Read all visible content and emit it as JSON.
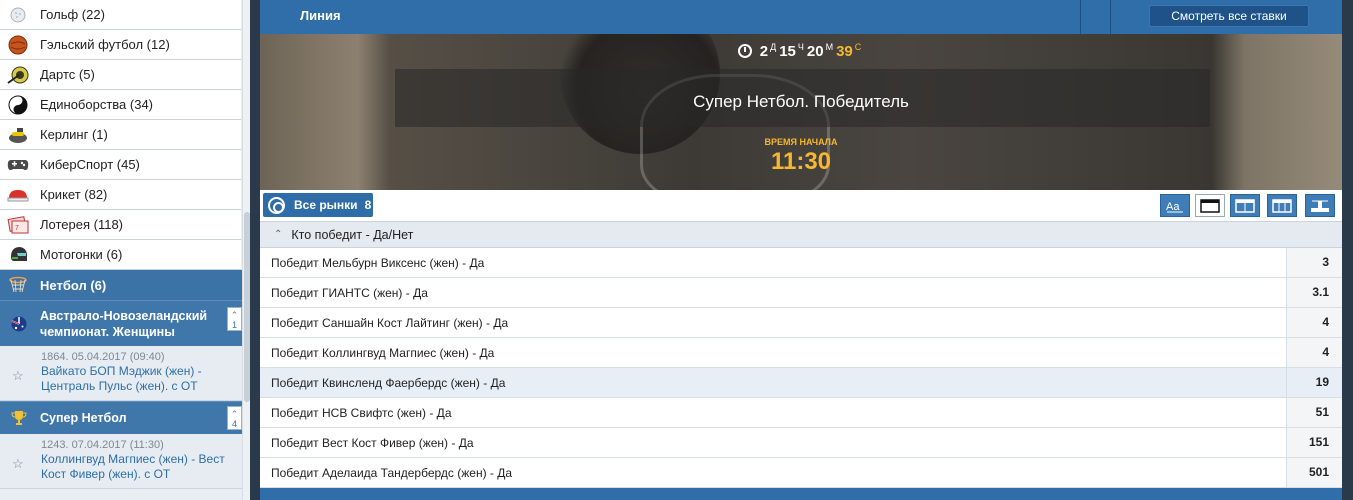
{
  "sidebar": {
    "sports": [
      {
        "label": "Гольф (22)",
        "icon": "golf-ball-icon"
      },
      {
        "label": "Гэльский футбол (12)",
        "icon": "gaelic-football-icon"
      },
      {
        "label": "Дартс (5)",
        "icon": "darts-icon"
      },
      {
        "label": "Единоборства (34)",
        "icon": "yin-yang-icon"
      },
      {
        "label": "Керлинг (1)",
        "icon": "curling-stone-icon"
      },
      {
        "label": "КиберСпорт (45)",
        "icon": "gamepad-icon"
      },
      {
        "label": "Крикет (82)",
        "icon": "cricket-icon"
      },
      {
        "label": "Лотерея (118)",
        "icon": "lottery-ticket-icon"
      },
      {
        "label": "Мотогонки (6)",
        "icon": "motorcycle-helmet-icon"
      }
    ],
    "active_sport": {
      "label": "Нетбол (6)",
      "icon": "netball-hoop-icon"
    },
    "leagues": [
      {
        "name": "Австрало-Новозеландский чемпионат. Женщины",
        "count": "1",
        "icon": "australia-flag-icon",
        "event": {
          "meta": "1864. 05.04.2017 (09:40)",
          "name": "Вайкато БОП Мэджик (жен) - Централь Пульс (жен). с ОТ"
        }
      },
      {
        "name": "Супер Нетбол",
        "count": "4",
        "icon": "trophy-icon",
        "event": {
          "meta": "1243. 07.04.2017 (11:30)",
          "name": "Коллингвуд Магпиес (жен) - Вест Кост Фивер (жен). с ОТ"
        }
      }
    ]
  },
  "topbar": {
    "title": "Линия",
    "all_bets_label": "Смотреть все ставки"
  },
  "banner": {
    "countdown": {
      "days": "2",
      "days_unit": "Д",
      "hours": "15",
      "hours_unit": "Ч",
      "minutes": "20",
      "minutes_unit": "М",
      "seconds": "39",
      "seconds_unit": "С"
    },
    "event_name": "Супер Нетбол. Победитель",
    "start_label": "ВРЕМЯ НАЧАЛА",
    "start_time": "11:30"
  },
  "markets": {
    "all_label": "Все рынки",
    "all_count": "8"
  },
  "group": {
    "title": "Кто победит - Да/Нет",
    "rows": [
      {
        "name": "Победит Мельбурн Виксенс (жен) - Да",
        "odd": "3"
      },
      {
        "name": "Победит ГИАНТС (жен) - Да",
        "odd": "3.1"
      },
      {
        "name": "Победит Саншайн Кост Лайтинг (жен) - Да",
        "odd": "4"
      },
      {
        "name": "Победит Коллингвуд Магпиес (жен) - Да",
        "odd": "4"
      },
      {
        "name": "Победит Квинсленд Фаербердс (жен) - Да",
        "odd": "19"
      },
      {
        "name": "Победит НСВ Свифтс (жен) - Да",
        "odd": "51"
      },
      {
        "name": "Победит Вест Кост Фивер (жен) - Да",
        "odd": "151"
      },
      {
        "name": "Победит Аделаида Тандербердс (жен) - Да",
        "odd": "501"
      }
    ]
  },
  "colors": {
    "accent": "#2f6ea9",
    "highlight": "#f5b82e"
  }
}
